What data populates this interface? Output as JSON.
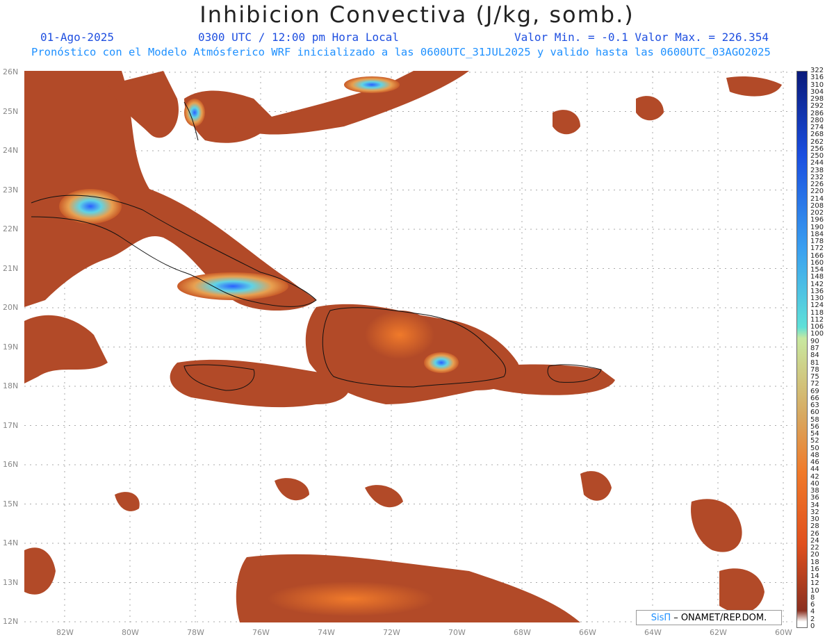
{
  "title": "Inhibicion Convectiva (J/kg, somb.)",
  "header": {
    "date": "01-Ago-2025",
    "time": "0300 UTC / 12:00 pm Hora Local",
    "range": "Valor Min. = -0.1  Valor Max. = 226.354",
    "subtitle": "Pronóstico con el Modelo Atmósferico WRF inicializado a las 0600UTC_31JUL2025 y valido hasta las  0600UTC_03AGO2025"
  },
  "axes": {
    "lon_labels": [
      "82W",
      "80W",
      "78W",
      "76W",
      "74W",
      "72W",
      "70W",
      "68W",
      "66W",
      "64W",
      "62W",
      "60W"
    ],
    "lat_labels": [
      "26N",
      "25N",
      "24N",
      "23N",
      "22N",
      "21N",
      "20N",
      "19N",
      "18N",
      "17N",
      "16N",
      "15N",
      "14N",
      "13N",
      "12N"
    ]
  },
  "colorbar": {
    "labels": [
      "322",
      "316",
      "310",
      "304",
      "298",
      "292",
      "286",
      "280",
      "274",
      "268",
      "262",
      "256",
      "250",
      "244",
      "238",
      "232",
      "226",
      "220",
      "214",
      "208",
      "202",
      "196",
      "190",
      "184",
      "178",
      "172",
      "166",
      "160",
      "154",
      "148",
      "142",
      "136",
      "130",
      "124",
      "118",
      "112",
      "106",
      "100",
      "90",
      "87",
      "84",
      "81",
      "78",
      "75",
      "72",
      "69",
      "66",
      "63",
      "60",
      "58",
      "56",
      "54",
      "52",
      "50",
      "48",
      "46",
      "44",
      "42",
      "40",
      "38",
      "36",
      "34",
      "32",
      "30",
      "28",
      "26",
      "24",
      "22",
      "20",
      "18",
      "16",
      "14",
      "12",
      "10",
      "8",
      "6",
      "4",
      "2",
      "0"
    ]
  },
  "credit": {
    "sis": "SisΠ",
    "text": "– ONAMET/REP.DOM."
  },
  "colors": {
    "land_field": "#b24a28",
    "hot": "#e8601f",
    "cool": "#5fd3e6",
    "max": "#1a3cff"
  }
}
